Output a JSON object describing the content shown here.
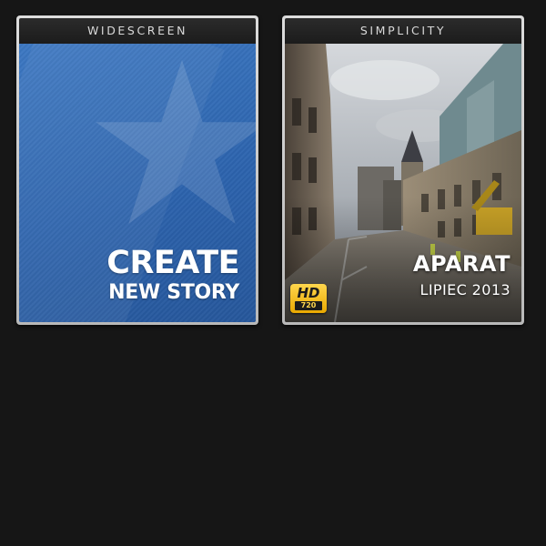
{
  "cards": [
    {
      "header": "WIDESCREEN",
      "line1": "CREATE",
      "line2": "NEW STORY",
      "icon": "star-icon"
    },
    {
      "header": "SIMPLICITY",
      "title": "APARAT",
      "subtitle": "LIPIEC 2013",
      "badge": {
        "label": "HD",
        "resolution": "720"
      }
    }
  ],
  "colors": {
    "background": "#161616",
    "card_blue": "#2c63ad",
    "badge_gold": "#f2bb1c"
  }
}
